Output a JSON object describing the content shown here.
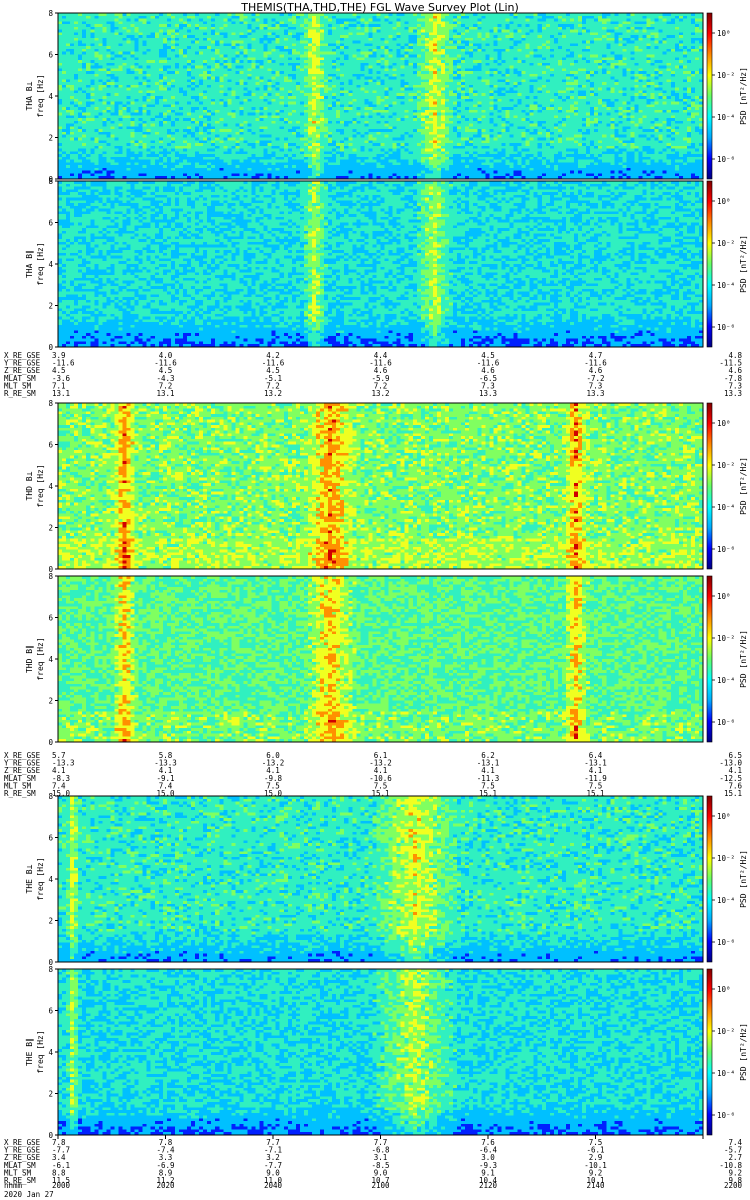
{
  "title": "THEMIS(THA,THD,THE) FGL Wave Survey Plot (Lin)",
  "colorbar_label": "PSD [nT²/Hz]",
  "colorbar_ticks": [
    "10⁰",
    "10⁻²",
    "10⁻⁴",
    "10⁻⁶"
  ],
  "freq_label": "freq [Hz]",
  "freq_ticks": [
    "0",
    "2",
    "4",
    "6",
    "8"
  ],
  "footer": {
    "time_label": "hhmm",
    "date": "2020 Jan 27"
  },
  "chart_data": {
    "type": "heatmap",
    "title": "THEMIS(THA,THD,THE) FGL Wave Survey Plot (Lin)",
    "xlabel": "hhmm",
    "ylabel": "freq [Hz]",
    "ylim": [
      0,
      8
    ],
    "x_ticks": [
      "2000",
      "2020",
      "2040",
      "2100",
      "2120",
      "2140",
      "2200"
    ],
    "colorbar": {
      "label": "PSD [nT²/Hz]",
      "scale": "log",
      "range": [
        1e-06,
        10
      ],
      "ticks": [
        "10⁰",
        "10⁻²",
        "10⁻⁴",
        "10⁻⁶"
      ]
    },
    "panels": [
      {
        "label": "THA B⊥",
        "probe": "THA",
        "component": "perp"
      },
      {
        "label": "THA B∥",
        "probe": "THA",
        "component": "par"
      },
      {
        "label": "THD B⊥",
        "probe": "THD",
        "component": "perp"
      },
      {
        "label": "THD B∥",
        "probe": "THD",
        "component": "par"
      },
      {
        "label": "THE B⊥",
        "probe": "THE",
        "component": "perp"
      },
      {
        "label": "THE B∥",
        "probe": "THE",
        "component": "par"
      }
    ],
    "ephemeris": [
      {
        "probe": "THA",
        "rows": [
          {
            "label": "X_RE_GSE",
            "values": [
              "3.9",
              "4.0",
              "4.2",
              "4.4",
              "4.5",
              "4.7",
              "4.8"
            ]
          },
          {
            "label": "Y_RE_GSE",
            "values": [
              "-11.6",
              "-11.6",
              "-11.6",
              "-11.6",
              "-11.6",
              "-11.6",
              "-11.5"
            ]
          },
          {
            "label": "Z_RE_GSE",
            "values": [
              "4.5",
              "4.5",
              "4.5",
              "4.6",
              "4.6",
              "4.6",
              "4.6"
            ]
          },
          {
            "label": "MLAT_SM",
            "values": [
              "-3.6",
              "-4.3",
              "-5.1",
              "-5.9",
              "-6.5",
              "-7.2",
              "-7.8"
            ]
          },
          {
            "label": "MLT_SM",
            "values": [
              "7.1",
              "7.2",
              "7.2",
              "7.2",
              "7.3",
              "7.3",
              "7.3"
            ]
          },
          {
            "label": "R_RE_SM",
            "values": [
              "13.1",
              "13.1",
              "13.2",
              "13.2",
              "13.3",
              "13.3",
              "13.3"
            ]
          }
        ]
      },
      {
        "probe": "THD",
        "rows": [
          {
            "label": "X_RE_GSE",
            "values": [
              "5.7",
              "5.8",
              "6.0",
              "6.1",
              "6.2",
              "6.4",
              "6.5"
            ]
          },
          {
            "label": "Y_RE_GSE",
            "values": [
              "-13.3",
              "-13.3",
              "-13.2",
              "-13.2",
              "-13.1",
              "-13.1",
              "-13.0"
            ]
          },
          {
            "label": "Z_RE_GSE",
            "values": [
              "4.1",
              "4.1",
              "4.1",
              "4.1",
              "4.1",
              "4.1",
              "4.1"
            ]
          },
          {
            "label": "MLAT_SM",
            "values": [
              "-8.3",
              "-9.1",
              "-9.8",
              "-10.6",
              "-11.3",
              "-11.9",
              "-12.5"
            ]
          },
          {
            "label": "MLT_SM",
            "values": [
              "7.4",
              "7.4",
              "7.5",
              "7.5",
              "7.5",
              "7.5",
              "7.6"
            ]
          },
          {
            "label": "R_RE_SM",
            "values": [
              "15.0",
              "15.0",
              "15.0",
              "15.1",
              "15.1",
              "15.1",
              "15.1"
            ]
          }
        ]
      },
      {
        "probe": "THE",
        "rows": [
          {
            "label": "X_RE_GSE",
            "values": [
              "7.8",
              "7.8",
              "7.7",
              "7.7",
              "7.6",
              "7.5",
              "7.4"
            ]
          },
          {
            "label": "Y_RE_GSE",
            "values": [
              "-7.7",
              "-7.4",
              "-7.1",
              "-6.8",
              "-6.4",
              "-6.1",
              "-5.7"
            ]
          },
          {
            "label": "Z_RE_GSE",
            "values": [
              "3.4",
              "3.3",
              "3.2",
              "3.1",
              "3.0",
              "2.9",
              "2.7"
            ]
          },
          {
            "label": "MLAT_SM",
            "values": [
              "-6.1",
              "-6.9",
              "-7.7",
              "-8.5",
              "-9.3",
              "-10.1",
              "-10.8"
            ]
          },
          {
            "label": "MLT_SM",
            "values": [
              "8.8",
              "8.9",
              "9.0",
              "9.0",
              "9.1",
              "9.2",
              "9.2"
            ]
          },
          {
            "label": "R_RE_SM",
            "values": [
              "11.5",
              "11.2",
              "11.0",
              "10.7",
              "10.4",
              "10.1",
              "9.8"
            ]
          }
        ]
      }
    ]
  },
  "colors": {
    "colormap": [
      "#000080",
      "#0000ff",
      "#00aaff",
      "#00ffff",
      "#66ff66",
      "#ffff00",
      "#ff8800",
      "#ff0000",
      "#800000"
    ]
  }
}
